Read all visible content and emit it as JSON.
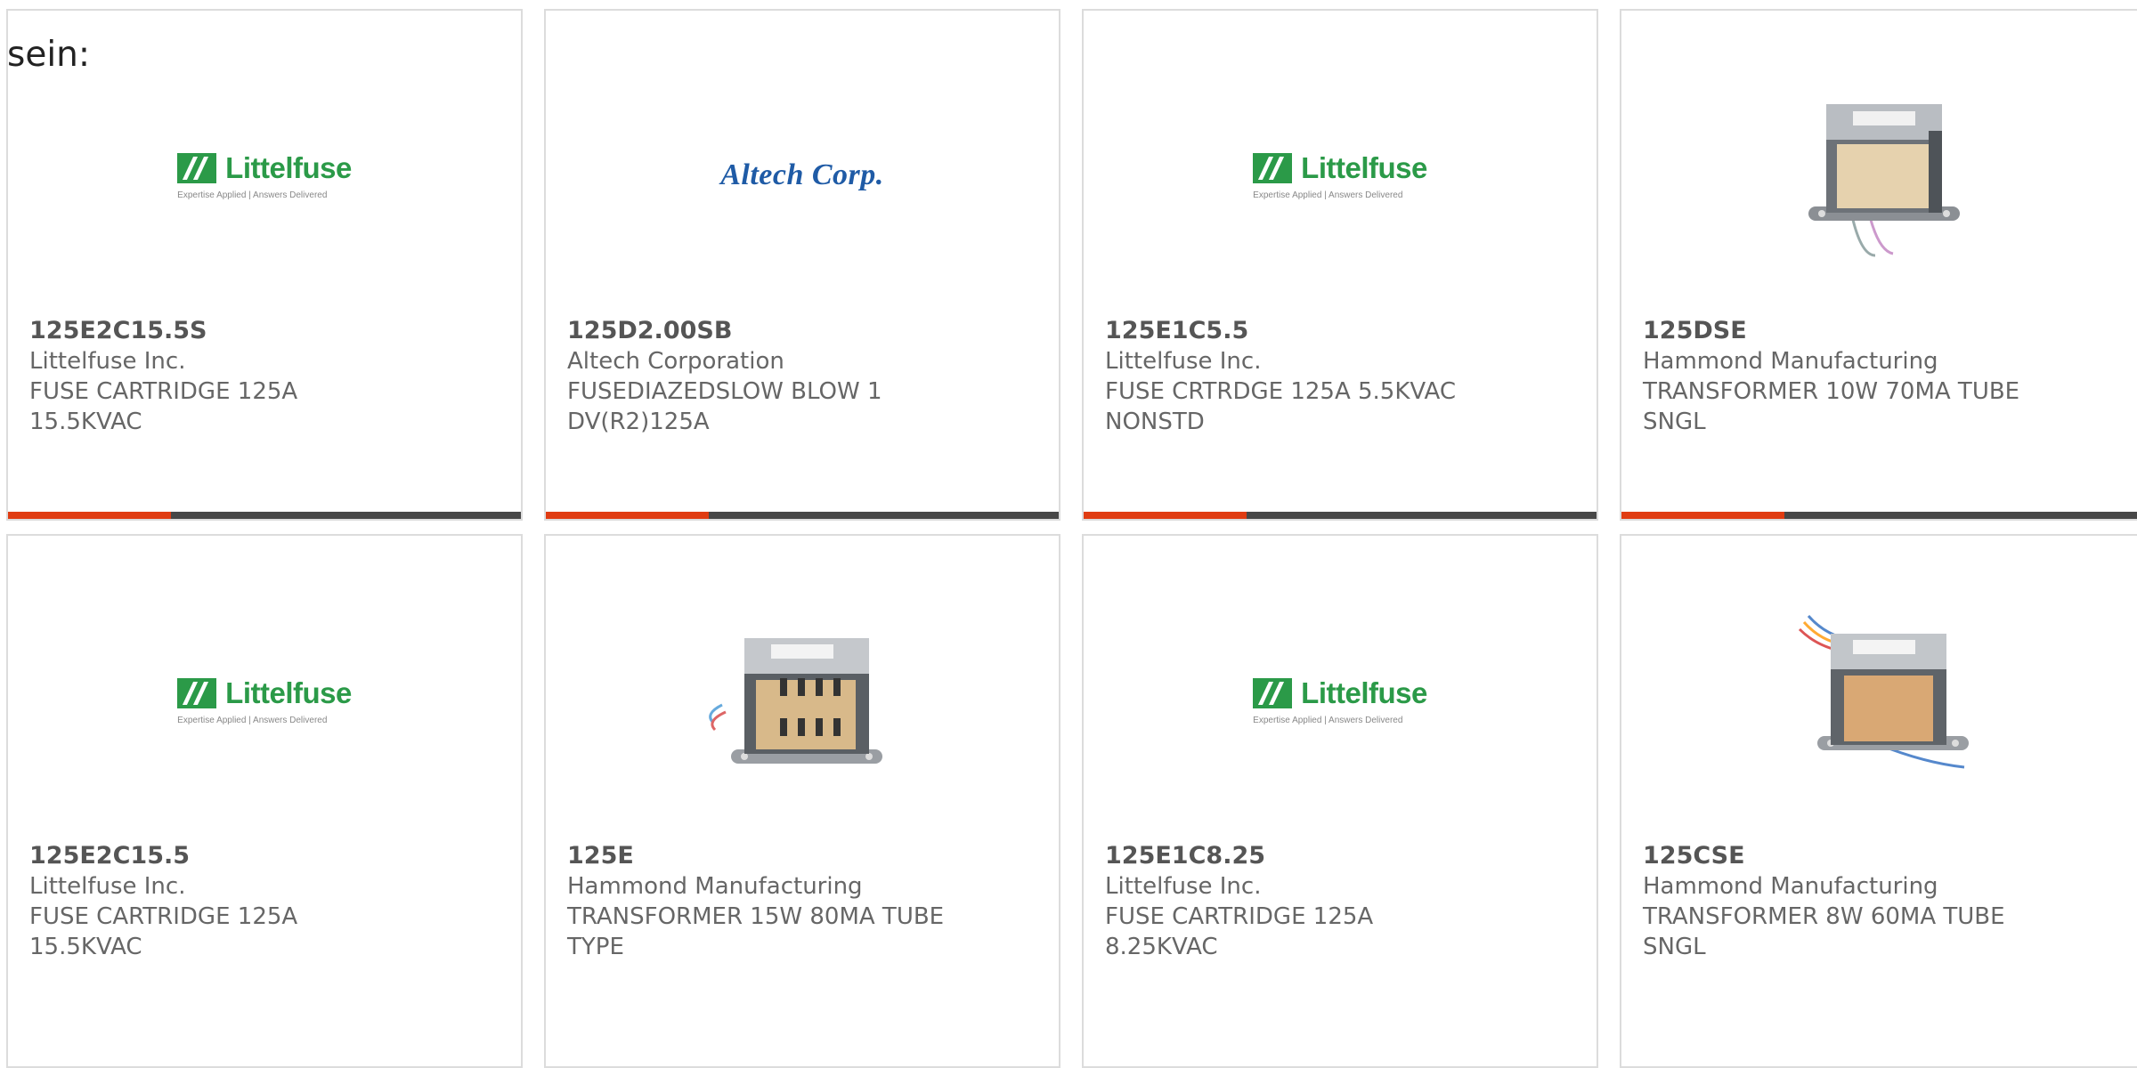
{
  "page": {
    "intro_text": "sein:"
  },
  "products": [
    {
      "part_number": "125E2C15.5S",
      "manufacturer": "Littelfuse Inc.",
      "desc_line1": "FUSE CARTRIDGE 125A",
      "desc_line2": "15.5KVAC",
      "image": "littelfuse-logo",
      "logo_text": "Littelfuse",
      "logo_tagline": "Expertise Applied | Answers Delivered"
    },
    {
      "part_number": "125D2.00SB",
      "manufacturer": "Altech Corporation",
      "desc_line1": "FUSEDIAZEDSLOW BLOW 1",
      "desc_line2": "DV(R2)125A",
      "image": "altech-logo",
      "logo_text": "Altech Corp."
    },
    {
      "part_number": "125E1C5.5",
      "manufacturer": "Littelfuse Inc.",
      "desc_line1": "FUSE CRTRDGE 125A 5.5KVAC",
      "desc_line2": "NONSTD",
      "image": "littelfuse-logo",
      "logo_text": "Littelfuse",
      "logo_tagline": "Expertise Applied | Answers Delivered"
    },
    {
      "part_number": "125DSE",
      "manufacturer": "Hammond Manufacturing",
      "desc_line1": "TRANSFORMER 10W 70MA TUBE",
      "desc_line2": "SNGL",
      "image": "transformer-photo"
    },
    {
      "part_number": "125E2C15.5",
      "manufacturer": "Littelfuse Inc.",
      "desc_line1": "FUSE CARTRIDGE 125A",
      "desc_line2": "15.5KVAC",
      "image": "littelfuse-logo",
      "logo_text": "Littelfuse",
      "logo_tagline": "Expertise Applied | Answers Delivered"
    },
    {
      "part_number": "125E",
      "manufacturer": "Hammond Manufacturing",
      "desc_line1": "TRANSFORMER 15W 80MA TUBE",
      "desc_line2": "TYPE",
      "image": "transformer-photo"
    },
    {
      "part_number": "125E1C8.25",
      "manufacturer": "Littelfuse Inc.",
      "desc_line1": "FUSE CARTRIDGE 125A",
      "desc_line2": "8.25KVAC",
      "image": "littelfuse-logo",
      "logo_text": "Littelfuse",
      "logo_tagline": "Expertise Applied | Answers Delivered"
    },
    {
      "part_number": "125CSE",
      "manufacturer": "Hammond Manufacturing",
      "desc_line1": "TRANSFORMER 8W 60MA TUBE",
      "desc_line2": "SNGL",
      "image": "transformer-photo"
    }
  ],
  "colors": {
    "accent": "#e03c12",
    "bar": "#474747",
    "littelfuse_green": "#2b9a48",
    "altech_blue": "#1f5ba6"
  }
}
